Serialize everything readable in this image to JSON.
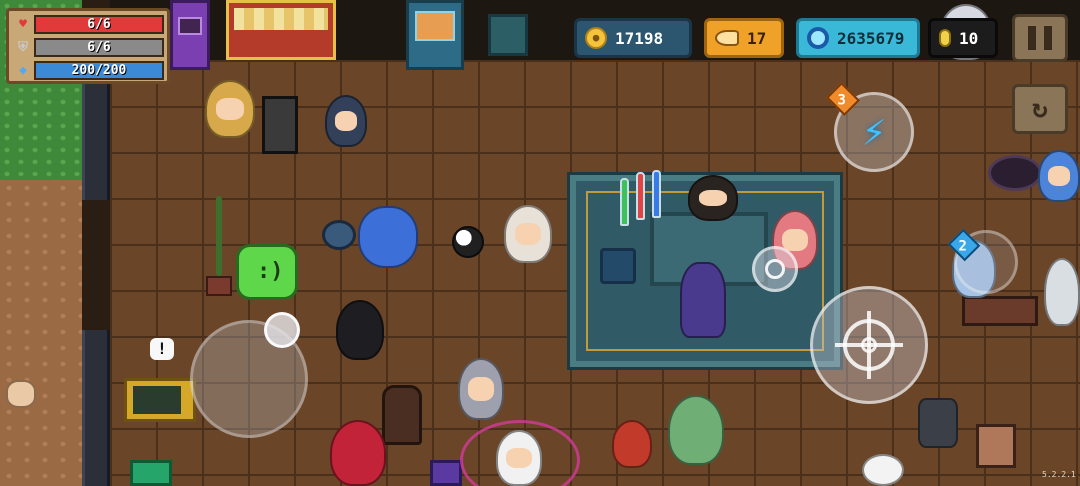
{
  "hud": {
    "health": {
      "label": "6/6",
      "value": 6,
      "max": 6,
      "color": "#e23a3a"
    },
    "armor": {
      "label": "6/6",
      "value": 6,
      "max": 6,
      "color": "#8a8a8a"
    },
    "energy": {
      "label": "200/200",
      "value": 200,
      "max": 200,
      "color": "#3a8ad8"
    }
  },
  "currency": {
    "gold": "17198",
    "fish": "17",
    "gems": "2635679",
    "tokens": "10"
  },
  "buttons": {
    "pause": "pause",
    "swap": "swap-weapon",
    "skill_charges": "3",
    "weapon_slot": "2"
  },
  "icons": {
    "health": "heart-icon",
    "armor": "shield-icon",
    "energy": "energy-diamond-icon",
    "gold": "coin-icon",
    "fish": "fish-icon",
    "gems": "gem-icon",
    "tokens": "token-icon",
    "skill": "lightning-icon",
    "attack": "crosshair-icon"
  },
  "slime_face": ":)",
  "alert_bubble": "!",
  "version": "5.2.2.1"
}
